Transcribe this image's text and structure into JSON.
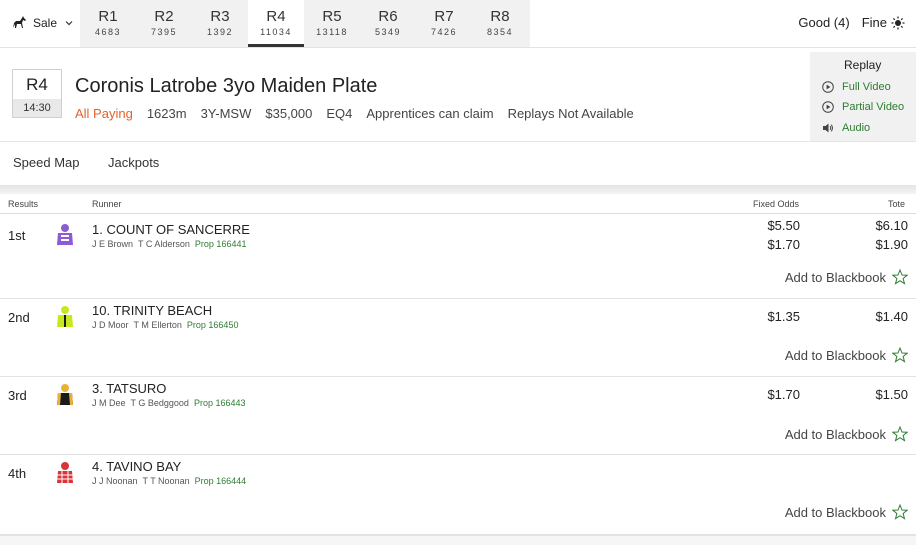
{
  "venue": {
    "label": "Sale"
  },
  "race_tabs": [
    {
      "label": "R1",
      "number": "4683"
    },
    {
      "label": "R2",
      "number": "7395"
    },
    {
      "label": "R3",
      "number": "1392"
    },
    {
      "label": "R4",
      "number": "11034"
    },
    {
      "label": "R5",
      "number": "13118"
    },
    {
      "label": "R6",
      "number": "5349"
    },
    {
      "label": "R7",
      "number": "7426"
    },
    {
      "label": "R8",
      "number": "8354"
    }
  ],
  "active_tab_index": 3,
  "conditions": {
    "track": "Good (4)",
    "weather": "Fine"
  },
  "race": {
    "badge": "R4",
    "time": "14:30",
    "title": "Coronis Latrobe 3yo Maiden Plate",
    "status": "All Paying",
    "distance": "1623m",
    "class": "3Y-MSW",
    "prize": "$35,000",
    "eq": "EQ4",
    "apprentices": "Apprentices can claim",
    "replays_note": "Replays Not Available"
  },
  "replay": {
    "title": "Replay",
    "full": "Full Video",
    "partial": "Partial Video",
    "audio": "Audio"
  },
  "subtabs": {
    "speed_map": "Speed Map",
    "jackpots": "Jackpots"
  },
  "table_headers": {
    "results": "Results",
    "runner": "Runner",
    "fixed_odds": "Fixed Odds",
    "tote": "Tote"
  },
  "results": [
    {
      "pos": "1st",
      "runner": "1. COUNT OF SANCERRE",
      "jockey": "J E Brown",
      "trainer": "T C Alderson",
      "prop": "Prop 166441",
      "fixed_win": "$5.50",
      "fixed_place": "$1.70",
      "tote_win": "$6.10",
      "tote_place": "$1.90",
      "blackbook": "Add to Blackbook",
      "silk_colors": [
        "#8e5bd6",
        "#ffffff"
      ]
    },
    {
      "pos": "2nd",
      "runner": "10. TRINITY BEACH",
      "jockey": "J D Moor",
      "trainer": "T M Ellerton",
      "prop": "Prop 166450",
      "fixed_win": "$1.35",
      "tote_win": "$1.40",
      "blackbook": "Add to Blackbook",
      "silk_colors": [
        "#c7e81c",
        "#1a1a1a"
      ]
    },
    {
      "pos": "3rd",
      "runner": "3. TATSURO",
      "jockey": "J M Dee",
      "trainer": "T G Bedggood",
      "prop": "Prop 166443",
      "fixed_win": "$1.70",
      "tote_win": "$1.50",
      "blackbook": "Add to Blackbook",
      "silk_colors": [
        "#1a1a1a",
        "#e8b23a"
      ]
    },
    {
      "pos": "4th",
      "runner": "4. TAVINO BAY",
      "jockey": "J J Noonan",
      "trainer": "T T Noonan",
      "prop": "Prop 166444",
      "blackbook": "Add to Blackbook",
      "silk_colors": [
        "#d9343a",
        "#ffffff"
      ]
    }
  ]
}
